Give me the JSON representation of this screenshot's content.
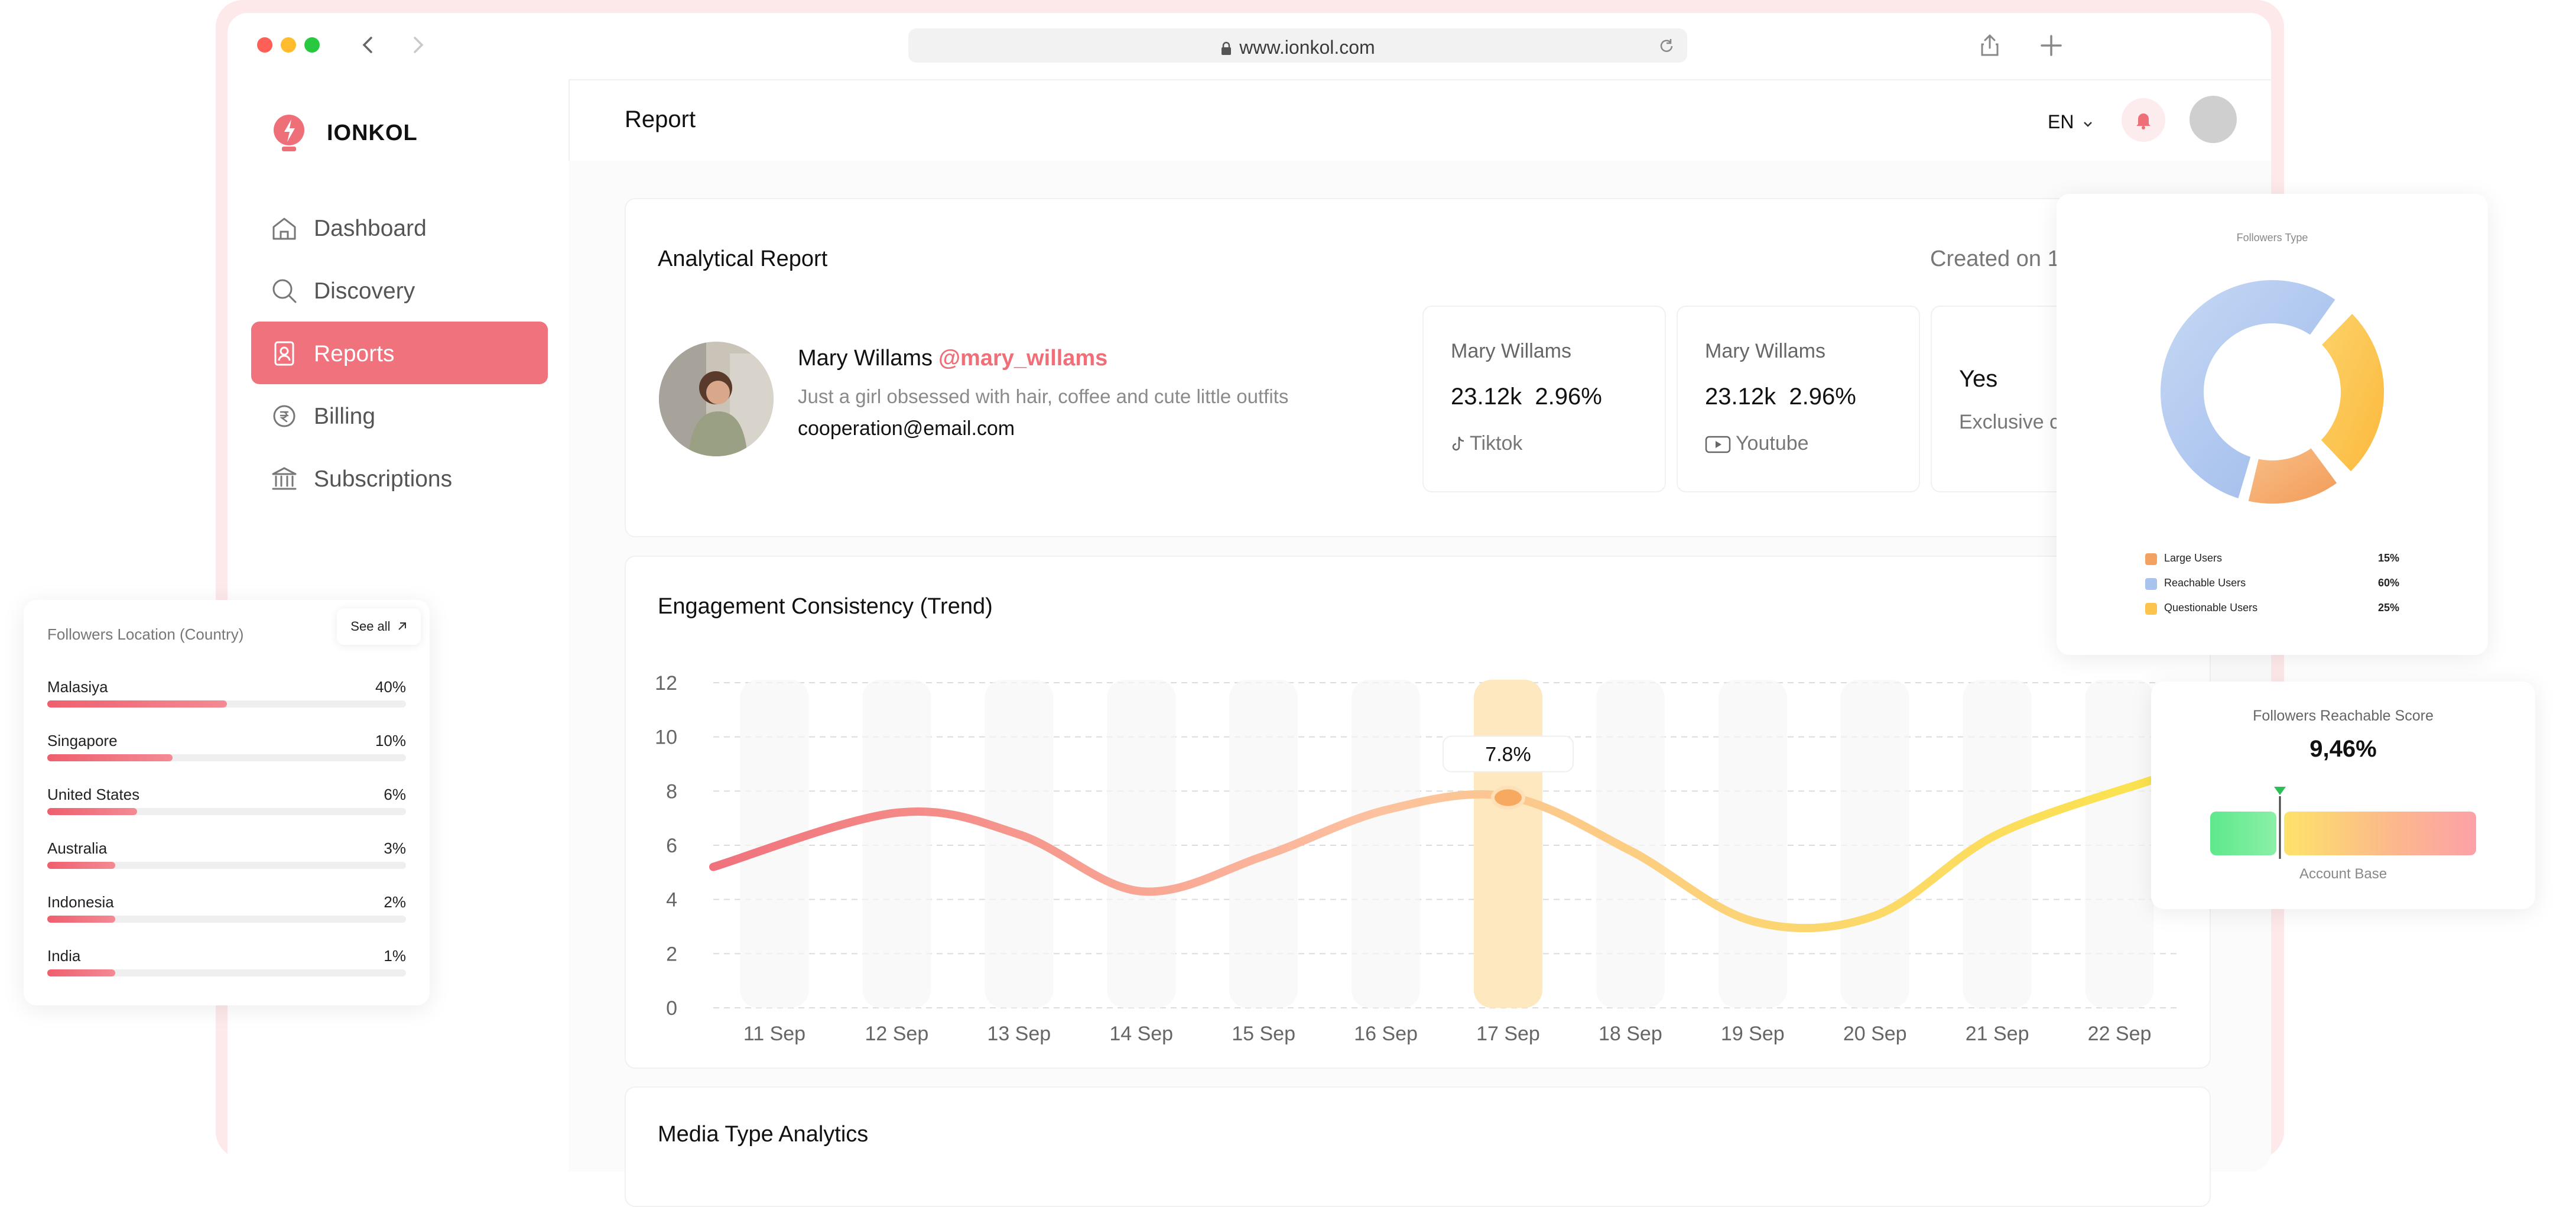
{
  "browser": {
    "url": "www.ionkol.com"
  },
  "app": {
    "brand": "IONKOL",
    "page_title": "Report",
    "language": "EN"
  },
  "sidebar": {
    "items": [
      {
        "label": "Dashboard"
      },
      {
        "label": "Discovery"
      },
      {
        "label": "Reports"
      },
      {
        "label": "Billing"
      },
      {
        "label": "Subscriptions"
      }
    ],
    "active": "Reports"
  },
  "report": {
    "title": "Analytical Report",
    "created_on": "Created on 1",
    "profile": {
      "name": "Mary Willams",
      "handle": "@mary_willams",
      "bio": "Just a girl obsessed with hair, coffee and cute little outfits",
      "email": "cooperation@email.com"
    },
    "stats": [
      {
        "name": "Mary Willams",
        "followers": "23.12k",
        "engagement": "2.96%",
        "platform": "Tiktok"
      },
      {
        "name": "Mary Willams",
        "followers": "23.12k",
        "engagement": "2.96%",
        "platform": "Youtube"
      }
    ],
    "exclusive": {
      "value": "Yes",
      "label": "Exclusive c"
    }
  },
  "engagement": {
    "title": "Engagement Consistency (Trend)",
    "tooltip": "7.8%"
  },
  "media": {
    "title": "Media Type Analytics"
  },
  "followers_location": {
    "title": "Followers Location (Country)",
    "see_all": "See all",
    "rows": [
      {
        "country": "Malasiya",
        "value": "40%",
        "fill": 0.5
      },
      {
        "country": "Singapore",
        "value": "10%",
        "fill": 0.35
      },
      {
        "country": "United States",
        "value": "6%",
        "fill": 0.25
      },
      {
        "country": "Australia",
        "value": "3%",
        "fill": 0.19
      },
      {
        "country": "Indonesia",
        "value": "2%",
        "fill": 0.19
      },
      {
        "country": "India",
        "value": "1%",
        "fill": 0.19
      }
    ]
  },
  "followers_type": {
    "title": "Followers Type",
    "legend": [
      {
        "label": "Large Users",
        "value": "15%",
        "color": "#f4a261"
      },
      {
        "label": "Reachable Users",
        "value": "60%",
        "color": "#a9c3ef"
      },
      {
        "label": "Questionable Users",
        "value": "25%",
        "color": "#fcc44c"
      }
    ]
  },
  "reachable_score": {
    "title": "Followers Reachable Score",
    "value": "9,46%",
    "footer": "Account Base"
  },
  "chart_data": {
    "type": "line",
    "title": "Engagement Consistency (Trend)",
    "categories": [
      "11 Sep",
      "12 Sep",
      "13 Sep",
      "14 Sep",
      "15 Sep",
      "16 Sep",
      "17 Sep",
      "18 Sep",
      "19 Sep",
      "20 Sep",
      "21 Sep",
      "22 Sep"
    ],
    "y_ticks": [
      12,
      10,
      8,
      6,
      4,
      2,
      0
    ],
    "ylim": [
      0,
      12
    ],
    "series": [
      {
        "values": [
          5.2,
          7.2,
          6.4,
          4.3,
          5.6,
          7.3,
          7.8,
          5.8,
          3.2,
          3.4,
          6.4,
          8.4
        ]
      }
    ],
    "highlight_category": "17 Sep",
    "highlight_label": "7.8%",
    "grid": true
  }
}
